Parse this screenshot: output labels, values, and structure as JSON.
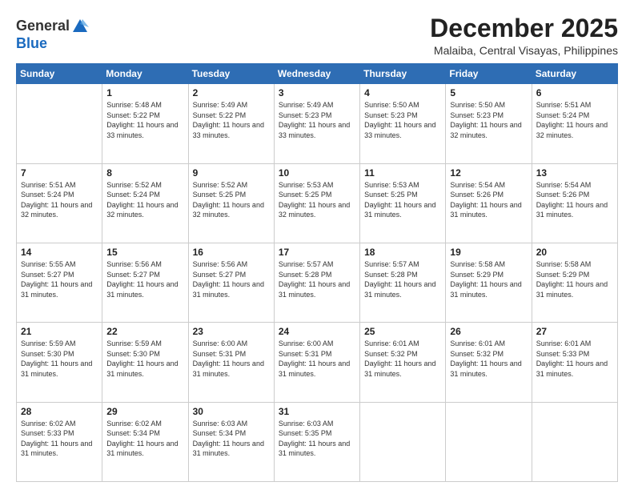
{
  "logo": {
    "general": "General",
    "blue": "Blue"
  },
  "title": "December 2025",
  "location": "Malaiba, Central Visayas, Philippines",
  "days_header": [
    "Sunday",
    "Monday",
    "Tuesday",
    "Wednesday",
    "Thursday",
    "Friday",
    "Saturday"
  ],
  "weeks": [
    [
      {
        "day": "",
        "sunrise": "",
        "sunset": "",
        "daylight": ""
      },
      {
        "day": "1",
        "sunrise": "Sunrise: 5:48 AM",
        "sunset": "Sunset: 5:22 PM",
        "daylight": "Daylight: 11 hours and 33 minutes."
      },
      {
        "day": "2",
        "sunrise": "Sunrise: 5:49 AM",
        "sunset": "Sunset: 5:22 PM",
        "daylight": "Daylight: 11 hours and 33 minutes."
      },
      {
        "day": "3",
        "sunrise": "Sunrise: 5:49 AM",
        "sunset": "Sunset: 5:23 PM",
        "daylight": "Daylight: 11 hours and 33 minutes."
      },
      {
        "day": "4",
        "sunrise": "Sunrise: 5:50 AM",
        "sunset": "Sunset: 5:23 PM",
        "daylight": "Daylight: 11 hours and 33 minutes."
      },
      {
        "day": "5",
        "sunrise": "Sunrise: 5:50 AM",
        "sunset": "Sunset: 5:23 PM",
        "daylight": "Daylight: 11 hours and 32 minutes."
      },
      {
        "day": "6",
        "sunrise": "Sunrise: 5:51 AM",
        "sunset": "Sunset: 5:24 PM",
        "daylight": "Daylight: 11 hours and 32 minutes."
      }
    ],
    [
      {
        "day": "7",
        "sunrise": "Sunrise: 5:51 AM",
        "sunset": "Sunset: 5:24 PM",
        "daylight": "Daylight: 11 hours and 32 minutes."
      },
      {
        "day": "8",
        "sunrise": "Sunrise: 5:52 AM",
        "sunset": "Sunset: 5:24 PM",
        "daylight": "Daylight: 11 hours and 32 minutes."
      },
      {
        "day": "9",
        "sunrise": "Sunrise: 5:52 AM",
        "sunset": "Sunset: 5:25 PM",
        "daylight": "Daylight: 11 hours and 32 minutes."
      },
      {
        "day": "10",
        "sunrise": "Sunrise: 5:53 AM",
        "sunset": "Sunset: 5:25 PM",
        "daylight": "Daylight: 11 hours and 32 minutes."
      },
      {
        "day": "11",
        "sunrise": "Sunrise: 5:53 AM",
        "sunset": "Sunset: 5:25 PM",
        "daylight": "Daylight: 11 hours and 31 minutes."
      },
      {
        "day": "12",
        "sunrise": "Sunrise: 5:54 AM",
        "sunset": "Sunset: 5:26 PM",
        "daylight": "Daylight: 11 hours and 31 minutes."
      },
      {
        "day": "13",
        "sunrise": "Sunrise: 5:54 AM",
        "sunset": "Sunset: 5:26 PM",
        "daylight": "Daylight: 11 hours and 31 minutes."
      }
    ],
    [
      {
        "day": "14",
        "sunrise": "Sunrise: 5:55 AM",
        "sunset": "Sunset: 5:27 PM",
        "daylight": "Daylight: 11 hours and 31 minutes."
      },
      {
        "day": "15",
        "sunrise": "Sunrise: 5:56 AM",
        "sunset": "Sunset: 5:27 PM",
        "daylight": "Daylight: 11 hours and 31 minutes."
      },
      {
        "day": "16",
        "sunrise": "Sunrise: 5:56 AM",
        "sunset": "Sunset: 5:27 PM",
        "daylight": "Daylight: 11 hours and 31 minutes."
      },
      {
        "day": "17",
        "sunrise": "Sunrise: 5:57 AM",
        "sunset": "Sunset: 5:28 PM",
        "daylight": "Daylight: 11 hours and 31 minutes."
      },
      {
        "day": "18",
        "sunrise": "Sunrise: 5:57 AM",
        "sunset": "Sunset: 5:28 PM",
        "daylight": "Daylight: 11 hours and 31 minutes."
      },
      {
        "day": "19",
        "sunrise": "Sunrise: 5:58 AM",
        "sunset": "Sunset: 5:29 PM",
        "daylight": "Daylight: 11 hours and 31 minutes."
      },
      {
        "day": "20",
        "sunrise": "Sunrise: 5:58 AM",
        "sunset": "Sunset: 5:29 PM",
        "daylight": "Daylight: 11 hours and 31 minutes."
      }
    ],
    [
      {
        "day": "21",
        "sunrise": "Sunrise: 5:59 AM",
        "sunset": "Sunset: 5:30 PM",
        "daylight": "Daylight: 11 hours and 31 minutes."
      },
      {
        "day": "22",
        "sunrise": "Sunrise: 5:59 AM",
        "sunset": "Sunset: 5:30 PM",
        "daylight": "Daylight: 11 hours and 31 minutes."
      },
      {
        "day": "23",
        "sunrise": "Sunrise: 6:00 AM",
        "sunset": "Sunset: 5:31 PM",
        "daylight": "Daylight: 11 hours and 31 minutes."
      },
      {
        "day": "24",
        "sunrise": "Sunrise: 6:00 AM",
        "sunset": "Sunset: 5:31 PM",
        "daylight": "Daylight: 11 hours and 31 minutes."
      },
      {
        "day": "25",
        "sunrise": "Sunrise: 6:01 AM",
        "sunset": "Sunset: 5:32 PM",
        "daylight": "Daylight: 11 hours and 31 minutes."
      },
      {
        "day": "26",
        "sunrise": "Sunrise: 6:01 AM",
        "sunset": "Sunset: 5:32 PM",
        "daylight": "Daylight: 11 hours and 31 minutes."
      },
      {
        "day": "27",
        "sunrise": "Sunrise: 6:01 AM",
        "sunset": "Sunset: 5:33 PM",
        "daylight": "Daylight: 11 hours and 31 minutes."
      }
    ],
    [
      {
        "day": "28",
        "sunrise": "Sunrise: 6:02 AM",
        "sunset": "Sunset: 5:33 PM",
        "daylight": "Daylight: 11 hours and 31 minutes."
      },
      {
        "day": "29",
        "sunrise": "Sunrise: 6:02 AM",
        "sunset": "Sunset: 5:34 PM",
        "daylight": "Daylight: 11 hours and 31 minutes."
      },
      {
        "day": "30",
        "sunrise": "Sunrise: 6:03 AM",
        "sunset": "Sunset: 5:34 PM",
        "daylight": "Daylight: 11 hours and 31 minutes."
      },
      {
        "day": "31",
        "sunrise": "Sunrise: 6:03 AM",
        "sunset": "Sunset: 5:35 PM",
        "daylight": "Daylight: 11 hours and 31 minutes."
      },
      {
        "day": "",
        "sunrise": "",
        "sunset": "",
        "daylight": ""
      },
      {
        "day": "",
        "sunrise": "",
        "sunset": "",
        "daylight": ""
      },
      {
        "day": "",
        "sunrise": "",
        "sunset": "",
        "daylight": ""
      }
    ]
  ]
}
